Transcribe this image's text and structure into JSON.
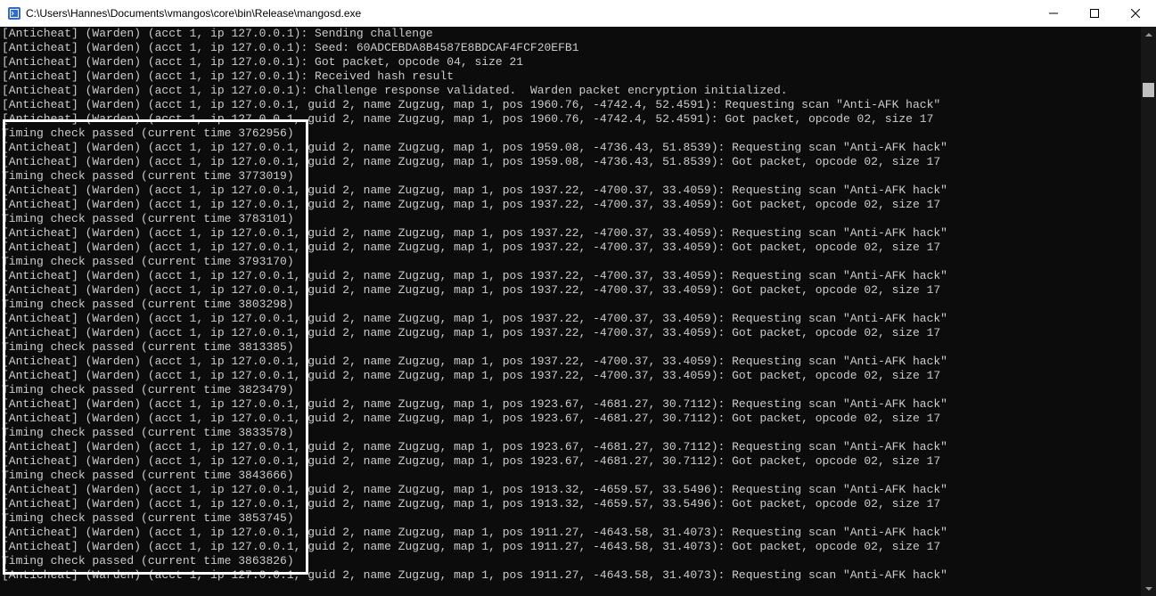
{
  "window": {
    "title": "C:\\Users\\Hannes\\Documents\\vmangos\\core\\bin\\Release\\mangosd.exe",
    "icon": "console-app-icon"
  },
  "controls": {
    "minimize_icon": "minimize-icon",
    "maximize_icon": "maximize-icon",
    "close_icon": "close-icon"
  },
  "console": {
    "lines": [
      "[Anticheat] (Warden) (acct 1, ip 127.0.0.1): Sending challenge",
      "[Anticheat] (Warden) (acct 1, ip 127.0.0.1): Seed: 60ADCEBDA8B4587E8BDCAF4FCF20EFB1",
      "[Anticheat] (Warden) (acct 1, ip 127.0.0.1): Got packet, opcode 04, size 21",
      "[Anticheat] (Warden) (acct 1, ip 127.0.0.1): Received hash result",
      "[Anticheat] (Warden) (acct 1, ip 127.0.0.1): Challenge response validated.  Warden packet encryption initialized.",
      "[Anticheat] (Warden) (acct 1, ip 127.0.0.1, guid 2, name Zugzug, map 1, pos 1960.76, -4742.4, 52.4591): Requesting scan \"Anti-AFK hack\"",
      "[Anticheat] (Warden) (acct 1, ip 127.0.0.1, guid 2, name Zugzug, map 1, pos 1960.76, -4742.4, 52.4591): Got packet, opcode 02, size 17",
      "Timing check passed (current time 3762956)",
      "[Anticheat] (Warden) (acct 1, ip 127.0.0.1, guid 2, name Zugzug, map 1, pos 1959.08, -4736.43, 51.8539): Requesting scan \"Anti-AFK hack\"",
      "[Anticheat] (Warden) (acct 1, ip 127.0.0.1, guid 2, name Zugzug, map 1, pos 1959.08, -4736.43, 51.8539): Got packet, opcode 02, size 17",
      "Timing check passed (current time 3773019)",
      "[Anticheat] (Warden) (acct 1, ip 127.0.0.1, guid 2, name Zugzug, map 1, pos 1937.22, -4700.37, 33.4059): Requesting scan \"Anti-AFK hack\"",
      "[Anticheat] (Warden) (acct 1, ip 127.0.0.1, guid 2, name Zugzug, map 1, pos 1937.22, -4700.37, 33.4059): Got packet, opcode 02, size 17",
      "Timing check passed (current time 3783101)",
      "[Anticheat] (Warden) (acct 1, ip 127.0.0.1, guid 2, name Zugzug, map 1, pos 1937.22, -4700.37, 33.4059): Requesting scan \"Anti-AFK hack\"",
      "[Anticheat] (Warden) (acct 1, ip 127.0.0.1, guid 2, name Zugzug, map 1, pos 1937.22, -4700.37, 33.4059): Got packet, opcode 02, size 17",
      "Timing check passed (current time 3793170)",
      "[Anticheat] (Warden) (acct 1, ip 127.0.0.1, guid 2, name Zugzug, map 1, pos 1937.22, -4700.37, 33.4059): Requesting scan \"Anti-AFK hack\"",
      "[Anticheat] (Warden) (acct 1, ip 127.0.0.1, guid 2, name Zugzug, map 1, pos 1937.22, -4700.37, 33.4059): Got packet, opcode 02, size 17",
      "Timing check passed (current time 3803298)",
      "[Anticheat] (Warden) (acct 1, ip 127.0.0.1, guid 2, name Zugzug, map 1, pos 1937.22, -4700.37, 33.4059): Requesting scan \"Anti-AFK hack\"",
      "[Anticheat] (Warden) (acct 1, ip 127.0.0.1, guid 2, name Zugzug, map 1, pos 1937.22, -4700.37, 33.4059): Got packet, opcode 02, size 17",
      "Timing check passed (current time 3813385)",
      "[Anticheat] (Warden) (acct 1, ip 127.0.0.1, guid 2, name Zugzug, map 1, pos 1937.22, -4700.37, 33.4059): Requesting scan \"Anti-AFK hack\"",
      "[Anticheat] (Warden) (acct 1, ip 127.0.0.1, guid 2, name Zugzug, map 1, pos 1937.22, -4700.37, 33.4059): Got packet, opcode 02, size 17",
      "Timing check passed (current time 3823479)",
      "[Anticheat] (Warden) (acct 1, ip 127.0.0.1, guid 2, name Zugzug, map 1, pos 1923.67, -4681.27, 30.7112): Requesting scan \"Anti-AFK hack\"",
      "[Anticheat] (Warden) (acct 1, ip 127.0.0.1, guid 2, name Zugzug, map 1, pos 1923.67, -4681.27, 30.7112): Got packet, opcode 02, size 17",
      "Timing check passed (current time 3833578)",
      "[Anticheat] (Warden) (acct 1, ip 127.0.0.1, guid 2, name Zugzug, map 1, pos 1923.67, -4681.27, 30.7112): Requesting scan \"Anti-AFK hack\"",
      "[Anticheat] (Warden) (acct 1, ip 127.0.0.1, guid 2, name Zugzug, map 1, pos 1923.67, -4681.27, 30.7112): Got packet, opcode 02, size 17",
      "Timing check passed (current time 3843666)",
      "[Anticheat] (Warden) (acct 1, ip 127.0.0.1, guid 2, name Zugzug, map 1, pos 1913.32, -4659.57, 33.5496): Requesting scan \"Anti-AFK hack\"",
      "[Anticheat] (Warden) (acct 1, ip 127.0.0.1, guid 2, name Zugzug, map 1, pos 1913.32, -4659.57, 33.5496): Got packet, opcode 02, size 17",
      "Timing check passed (current time 3853745)",
      "[Anticheat] (Warden) (acct 1, ip 127.0.0.1, guid 2, name Zugzug, map 1, pos 1911.27, -4643.58, 31.4073): Requesting scan \"Anti-AFK hack\"",
      "[Anticheat] (Warden) (acct 1, ip 127.0.0.1, guid 2, name Zugzug, map 1, pos 1911.27, -4643.58, 31.4073): Got packet, opcode 02, size 17",
      "Timing check passed (current time 3863826)",
      "[Anticheat] (Warden) (acct 1, ip 127.0.0.1, guid 2, name Zugzug, map 1, pos 1911.27, -4643.58, 31.4073): Requesting scan \"Anti-AFK hack\""
    ]
  },
  "colors": {
    "background": "#0c0c0c",
    "text": "#cccccc",
    "titlebar": "#ffffff",
    "highlight": "#ffffff"
  }
}
